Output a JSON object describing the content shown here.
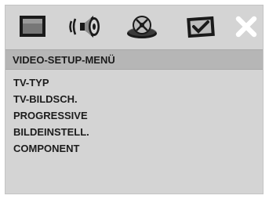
{
  "toolbar": {
    "icons": [
      "general-setup-icon",
      "audio-setup-icon",
      "video-setup-icon",
      "preferences-icon",
      "exit-icon"
    ],
    "active_icon": "video-setup-icon"
  },
  "menu": {
    "title": "VIDEO-SETUP-MENÜ",
    "items": [
      {
        "label": "TV-TYP"
      },
      {
        "label": "TV-BILDSCH."
      },
      {
        "label": "PROGRESSIVE"
      },
      {
        "label": "BILDEINSTELL."
      },
      {
        "label": "COMPONENT"
      }
    ]
  },
  "colors": {
    "panel": "#d4d4d4",
    "title_bar": "#b6b6b6",
    "text": "#1c1c1c",
    "icon_dark": "#1a1a1a"
  }
}
